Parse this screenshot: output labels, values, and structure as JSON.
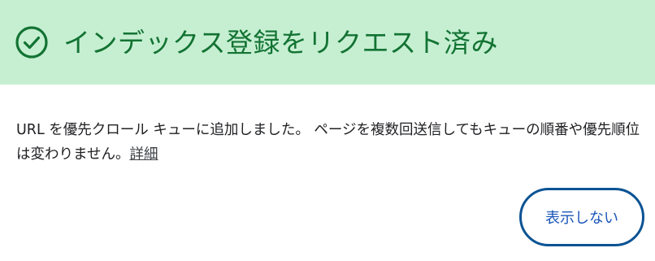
{
  "header": {
    "icon": "check-circle-icon",
    "title": "インデックス登録をリクエスト済み",
    "background_color": "#c6efd2",
    "accent_color": "#137333"
  },
  "message": {
    "text": "URL を優先クロール キューに追加しました。 ページを複数回送信してもキューの順番や優先順位は変わりません。",
    "learn_more_link": "詳細"
  },
  "actions": {
    "dismiss_label": "表示しない",
    "dismiss_color": "#1a56b8"
  }
}
